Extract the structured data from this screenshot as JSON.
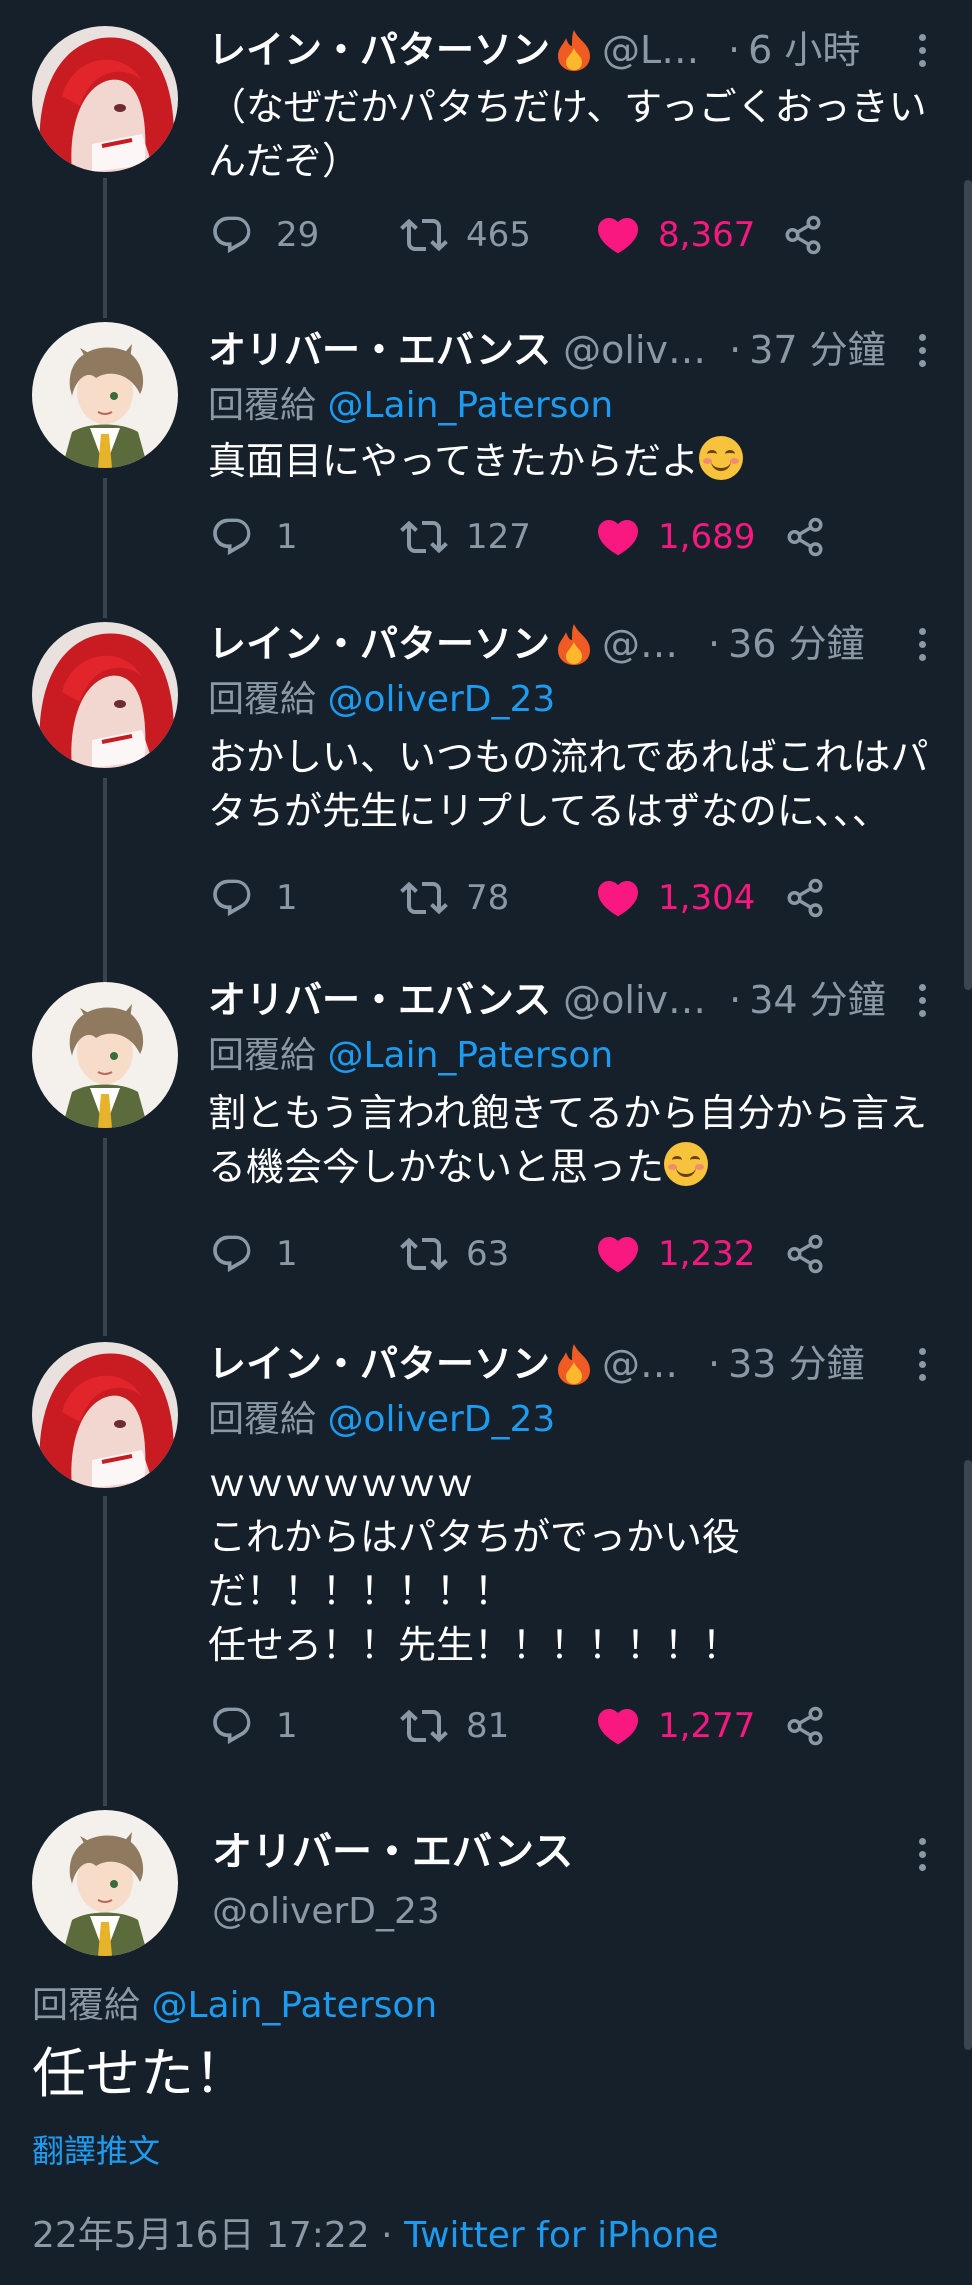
{
  "colors": {
    "background": "#15202b",
    "muted": "#8b98a5",
    "link": "#1d9bf0",
    "like": "#f91880",
    "thread_line": "#38444d"
  },
  "tweets": [
    {
      "name": "レイン・パターソン",
      "handle": "@Lai...",
      "sep": "·",
      "time": "6 小時",
      "reply_prefix": "",
      "reply_to": "",
      "text": "（なぜだかパタちだけ、すっごくおっきいんだぞ）",
      "replies": "29",
      "retweets": "465",
      "likes": "8,367"
    },
    {
      "name": "オリバー・エバンス",
      "handle": "@olive...",
      "sep": "·",
      "time": "37 分鐘",
      "reply_prefix": "回覆給",
      "reply_to": "@Lain_Paterson",
      "text": "真面目にやってきたからだよ",
      "replies": "1",
      "retweets": "127",
      "likes": "1,689"
    },
    {
      "name": "レイン・パターソン",
      "handle": "@L...",
      "sep": "·",
      "time": "36 分鐘",
      "reply_prefix": "回覆給",
      "reply_to": "@oliverD_23",
      "text": "おかしい、いつもの流れであればこれはパタちが先生にリプしてるはずなのに、、、",
      "replies": "1",
      "retweets": "78",
      "likes": "1,304"
    },
    {
      "name": "オリバー・エバンス",
      "handle": "@olive...",
      "sep": "·",
      "time": "34 分鐘",
      "reply_prefix": "回覆給",
      "reply_to": "@Lain_Paterson",
      "text": "割ともう言われ飽きてるから自分から言える機会今しかないと思った",
      "replies": "1",
      "retweets": "63",
      "likes": "1,232"
    },
    {
      "name": "レイン・パターソン",
      "handle": "@L...",
      "sep": "·",
      "time": "33 分鐘",
      "reply_prefix": "回覆給",
      "reply_to": "@oliverD_23",
      "text": "ｗｗｗｗｗｗｗ\nこれからはパタちがでっかい役\nだ！！！！！！！\n任せろ！！先生！！！！！！！",
      "replies": "1",
      "retweets": "81",
      "likes": "1,277"
    }
  ],
  "main_tweet": {
    "name": "オリバー・エバンス",
    "handle": "@oliverD_23",
    "reply_prefix": "回覆給",
    "reply_to": "@Lain_Paterson",
    "text": "任せた！",
    "translate": "翻譯推文",
    "date": "22年5月16日 17:22",
    "sep": "·",
    "source": "Twitter for iPhone"
  }
}
